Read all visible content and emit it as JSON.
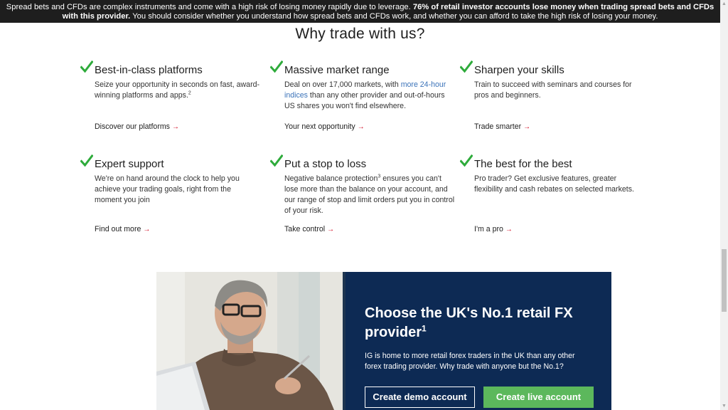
{
  "risk_banner": {
    "text_regular": "Spread bets and CFDs are complex instruments and come with a high risk of losing money rapidly due to leverage.",
    "text_bold": "76% of retail investor accounts lose money when trading spread bets and CFDs with this provider.",
    "text_tail": "You should consider whether you understand how spread bets and CFDs work, and whether you can afford to take the high risk of losing your money."
  },
  "section_title": "Why trade with us?",
  "features": [
    {
      "title": "Best-in-class platforms",
      "desc": "Seize your opportunity in seconds on fast, award-winning platforms and apps.",
      "desc_sup": "2",
      "cta": "Discover our platforms"
    },
    {
      "title": "Massive market range",
      "desc_pre": "Deal on over 17,000 markets, with ",
      "desc_link": "more 24-hour indices",
      "desc_post": " than any other provider and out-of-hours US shares you won't find elsewhere.",
      "cta": "Your next opportunity"
    },
    {
      "title": "Sharpen your skills",
      "desc": "Train to succeed with seminars and courses for pros and beginners.",
      "cta": "Trade smarter"
    },
    {
      "title": "Expert support",
      "desc": "We're on hand around the clock to help you achieve your trading goals, right from the moment you join",
      "cta": "Find out more"
    },
    {
      "title": "Put a stop to loss",
      "desc_pre": "Negative balance protection",
      "desc_sup": "3",
      "desc_post": " ensures you can't lose more than the balance on your account, and our range of stop and limit orders put you in control of your risk.",
      "cta": "Take control"
    },
    {
      "title": "The best for the best",
      "desc": "Pro trader? Get exclusive features, greater flexibility and cash rebates on selected markets.",
      "cta": "I'm a pro"
    }
  ],
  "cta_arrow": "→",
  "promo": {
    "heading": "Choose the UK's No.1 retail FX provider",
    "heading_sup": "1",
    "text": "IG is home to more retail forex traders in the UK than any other forex trading provider. Why trade with anyone but the No.1?",
    "demo_button": "Create demo account",
    "live_button": "Create live account"
  },
  "colors": {
    "banner_bg": "#1e1e1e",
    "check_green": "#2eab3b",
    "link_blue": "#3b73b9",
    "arrow_red": "#d0021b",
    "promo_bg": "#0d2a54",
    "live_button_bg": "#5cb85c"
  },
  "icons": {
    "feature_check": "checkmark-icon",
    "cta_arrow": "arrow-right-icon"
  }
}
